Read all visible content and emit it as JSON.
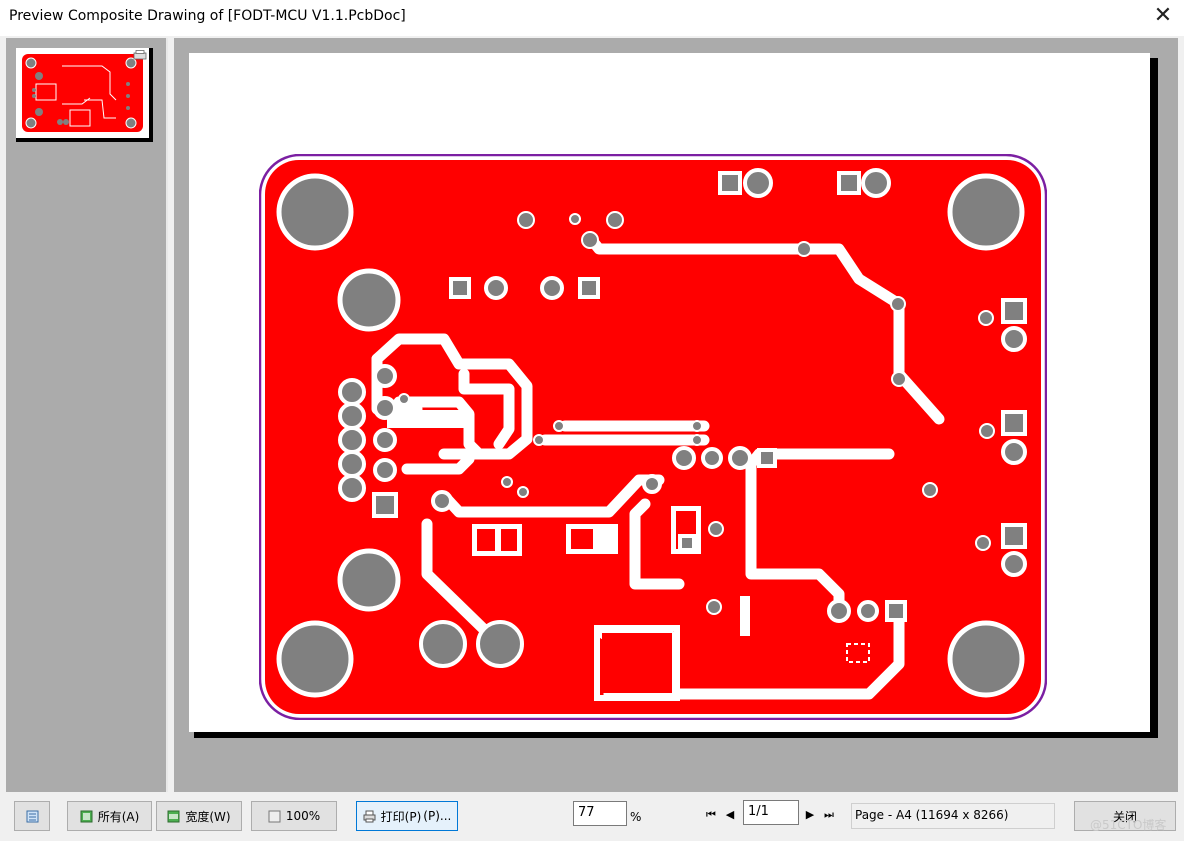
{
  "window": {
    "title": "Preview Composite Drawing of [FODT-MCU V1.1.PcbDoc]",
    "close_glyph": "✕"
  },
  "colors": {
    "board_red": "#ff0000",
    "outline_purple": "#7b1fa2",
    "pad_gray": "#808080",
    "pane_gray": "#ababab"
  },
  "icons": {
    "thumbnail_printer": "printer-icon",
    "single_page_view": "page-icon",
    "all_button": "page-green-icon",
    "width_button": "page-green-icon",
    "zoom_100_button": "page-icon",
    "print_button": "printer-icon"
  },
  "toolbar": {
    "all_label": "所有(A)",
    "all_accel": "(A)",
    "width_label": "宽度(W)",
    "width_accel": "(W)",
    "hundred_label": "100%",
    "print_label": "打印(P)",
    "print_accel": "(P)...",
    "zoom_value": "77",
    "zoom_unit": "%",
    "page_value": "1/1",
    "nav_first": "⏮",
    "nav_prev": "◀",
    "nav_next": "▶",
    "nav_last": "⏭",
    "page_info": "Page - A4 (11694 x 8266)",
    "close_label": "关闭"
  },
  "watermark": "@51CTO博客"
}
